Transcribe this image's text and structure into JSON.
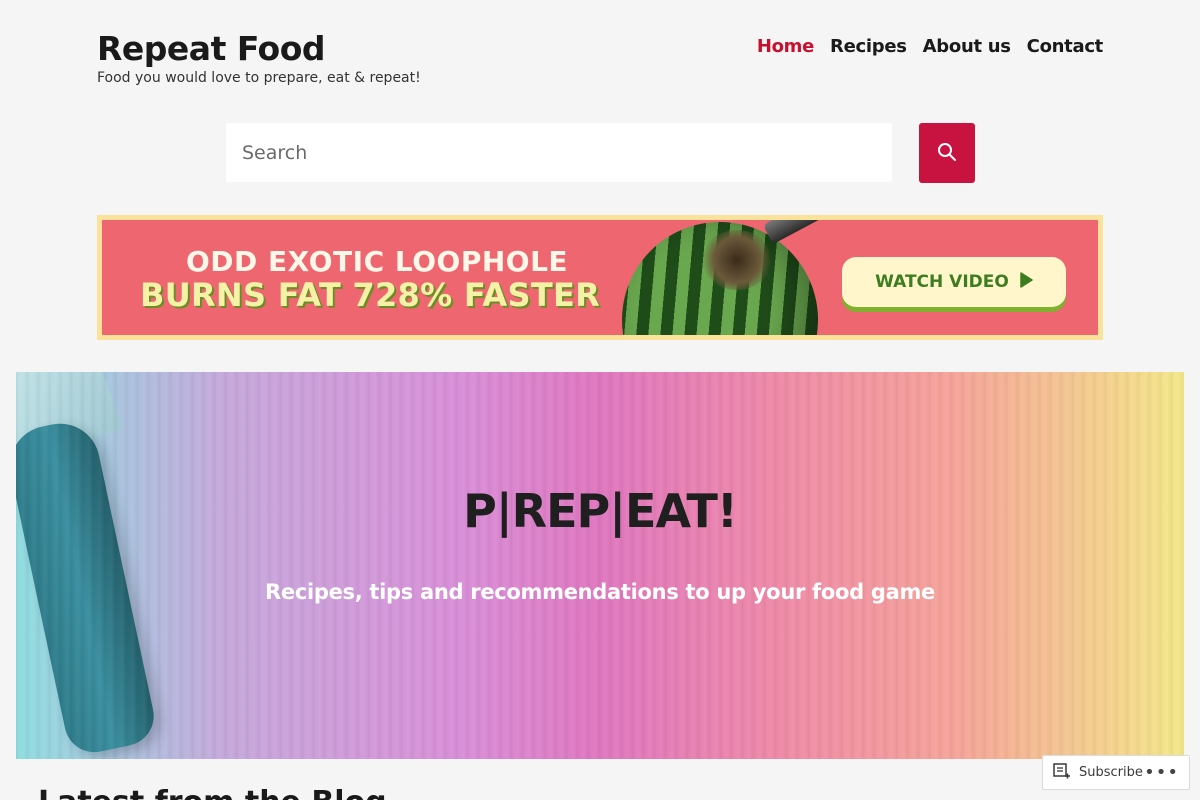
{
  "site": {
    "title": "Repeat Food",
    "tagline": "Food you would love to prepare, eat & repeat!"
  },
  "nav": {
    "items": [
      {
        "label": "Home",
        "current": true
      },
      {
        "label": "Recipes",
        "current": false
      },
      {
        "label": "About us",
        "current": false
      },
      {
        "label": "Contact",
        "current": false
      }
    ]
  },
  "search": {
    "placeholder": "Search",
    "button_icon": "search-icon"
  },
  "ad": {
    "line1": "ODD EXOTIC LOOPHOLE",
    "line2": "BURNS FAT 728% FASTER",
    "button_label": "WATCH VIDEO",
    "button_icon": "play-icon"
  },
  "hero": {
    "title": "P|REP|EAT!",
    "subtitle": "Recipes, tips and recommendations to up your food game"
  },
  "section": {
    "heading": "Latest from the Blog"
  },
  "subscribe": {
    "label": "Subscribe",
    "icon": "reader-icon",
    "more_label": "•••"
  },
  "colors": {
    "accent": "#c8123f",
    "nav_current": "#c8102e",
    "background": "#f5f5f5"
  }
}
